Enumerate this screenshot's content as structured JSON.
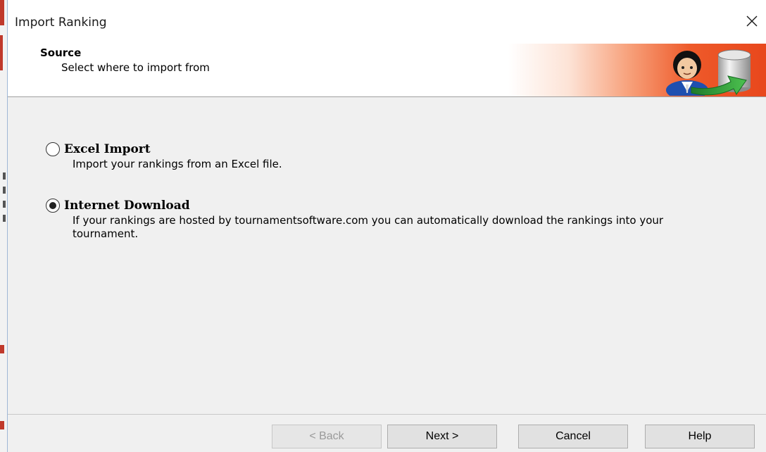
{
  "window": {
    "title": "Import Ranking"
  },
  "header": {
    "title": "Source",
    "subtitle": "Select where to import from"
  },
  "options": [
    {
      "label": "Excel Import",
      "description": "Import your rankings from an Excel file.",
      "selected": false
    },
    {
      "label": "Internet Download",
      "description": "If your rankings are hosted by tournamentsoftware.com you can automatically download the rankings into your tournament.",
      "selected": true
    }
  ],
  "buttons": {
    "back": "< Back",
    "next": "Next >",
    "cancel": "Cancel",
    "help": "Help"
  },
  "icons": {
    "close": "close-icon",
    "wizard": "user-database-import-icon"
  },
  "colors": {
    "header_accent": "#e8471c",
    "arrow_green": "#2e9e3a"
  }
}
